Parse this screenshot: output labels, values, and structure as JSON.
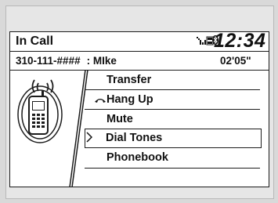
{
  "header": {
    "title": "In Call",
    "time": "12:34",
    "status_icons": [
      "signal-icon",
      "roam-icon",
      "bluetooth-icon"
    ]
  },
  "call": {
    "number": "310-111-####",
    "name": ": MIke",
    "duration": "02'05\""
  },
  "menu": {
    "items": [
      {
        "label": "Transfer",
        "icon": ""
      },
      {
        "label": "Hang Up",
        "icon": "hang-up-icon"
      },
      {
        "label": "Mute",
        "icon": ""
      },
      {
        "label": "Dial Tones",
        "icon": "",
        "selected": true
      },
      {
        "label": "Phonebook",
        "icon": ""
      }
    ]
  },
  "colors": {
    "screen": "#ffffff",
    "ink": "#1c1c1c",
    "bezel": "#e6e6e6"
  }
}
